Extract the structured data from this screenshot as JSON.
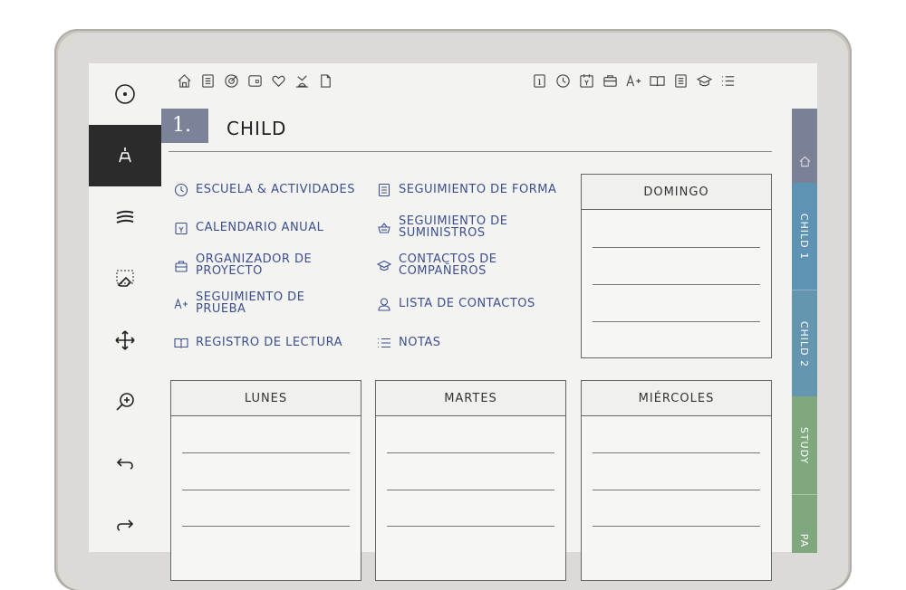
{
  "colors": {
    "accent": "#3e4f8c",
    "badge": "#7b8398",
    "tab_home": "#7a8196",
    "tab_child1": "#5e93b3",
    "tab_child2": "#6496b0",
    "tab_study": "#7fa87f",
    "tab_pa": "#7fa87f"
  },
  "toolbar": {
    "items": [
      "view-icon",
      "pen-icon",
      "brush-icon",
      "eraser-icon",
      "move-icon",
      "zoom-icon",
      "undo-icon",
      "redo-icon"
    ]
  },
  "page": {
    "number": "1.",
    "title": "CHILD"
  },
  "top_icons_left": [
    "home-icon",
    "clipboard-icon",
    "target-icon",
    "wallet-icon",
    "heart-icon",
    "scale-icon",
    "document-icon"
  ],
  "top_icons_right": [
    "info-icon",
    "clock-icon",
    "calendar-icon",
    "briefcase-icon",
    "grade-icon",
    "book-icon",
    "notes-icon",
    "graduation-icon",
    "list-icon"
  ],
  "links": [
    {
      "label": "ESCUELA & ACTIVIDADES",
      "icon": "clock-icon"
    },
    {
      "label": "SEGUIMIENTO DE FORMA",
      "icon": "clipboard-icon"
    },
    {
      "label": "CALENDARIO ANUAL",
      "icon": "calendar-icon"
    },
    {
      "label1": "SEGUIMIENTO DE",
      "label2": "SUMINISTROS",
      "icon": "basket-icon"
    },
    {
      "label1": "ORGANIZADOR DE",
      "label2": "PROYECTO",
      "icon": "briefcase-icon"
    },
    {
      "label1": "CONTACTOS DE",
      "label2": "COMPAÑEROS",
      "icon": "graduation-icon"
    },
    {
      "label1": "SEGUIMIENTO DE",
      "label2": "PRUEBA",
      "icon": "grade-icon"
    },
    {
      "label": "LISTA DE CONTACTOS",
      "icon": "person-icon"
    },
    {
      "label": "REGISTRO DE LECTURA",
      "icon": "book-icon"
    },
    {
      "label": "NOTAS",
      "icon": "list-icon"
    }
  ],
  "days": {
    "sunday": "DOMINGO",
    "monday": "LUNES",
    "tuesday": "MARTES",
    "wednesday": "MIÉRCOLES"
  },
  "tabs": {
    "home": "",
    "child1": "CHILD 1",
    "child2": "CHILD 2",
    "study": "STUDY",
    "pa": "PA"
  }
}
